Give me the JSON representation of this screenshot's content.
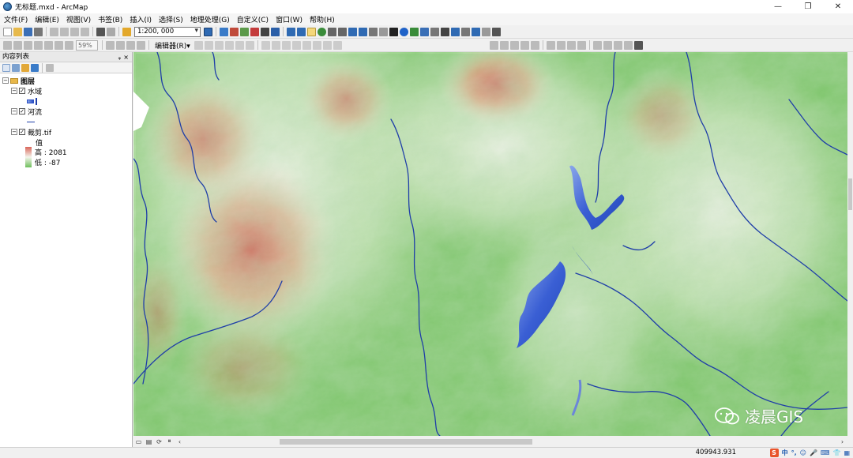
{
  "window": {
    "title": "无标题.mxd - ArcMap",
    "minimize": "—",
    "maximize": "❐",
    "close": "✕"
  },
  "menu": [
    "文件(F)",
    "编辑(E)",
    "视图(V)",
    "书签(B)",
    "插入(I)",
    "选择(S)",
    "地理处理(G)",
    "自定义(C)",
    "窗口(W)",
    "帮助(H)"
  ],
  "toolbar": {
    "scale": "1:200, 000",
    "zoom_percent": "59%",
    "editor_label": "编辑器(R)▾"
  },
  "toc": {
    "title": "内容列表",
    "pin": "ᵩ",
    "close": "×",
    "root": "图层",
    "layers": [
      {
        "name": "水域",
        "checked": true
      },
      {
        "name": "河流",
        "checked": true
      },
      {
        "name": "裁剪.tif",
        "checked": true,
        "legend_title": "值",
        "high": "高 : 2081",
        "low": "低 : -87"
      }
    ]
  },
  "status": {
    "coordinates": "409943.931"
  },
  "ime": {
    "items": [
      "中",
      "°,",
      "☺",
      "🎤",
      "⌨",
      "👕",
      "▦"
    ]
  },
  "watermark": {
    "text": "凌晨GIS"
  },
  "colors": {
    "low_green": "#6fbf5c",
    "mid_white": "#f4f4ec",
    "high_red": "#d9665a",
    "water_blue": "#2a4fc4",
    "river_blue": "#1f3ea8"
  }
}
